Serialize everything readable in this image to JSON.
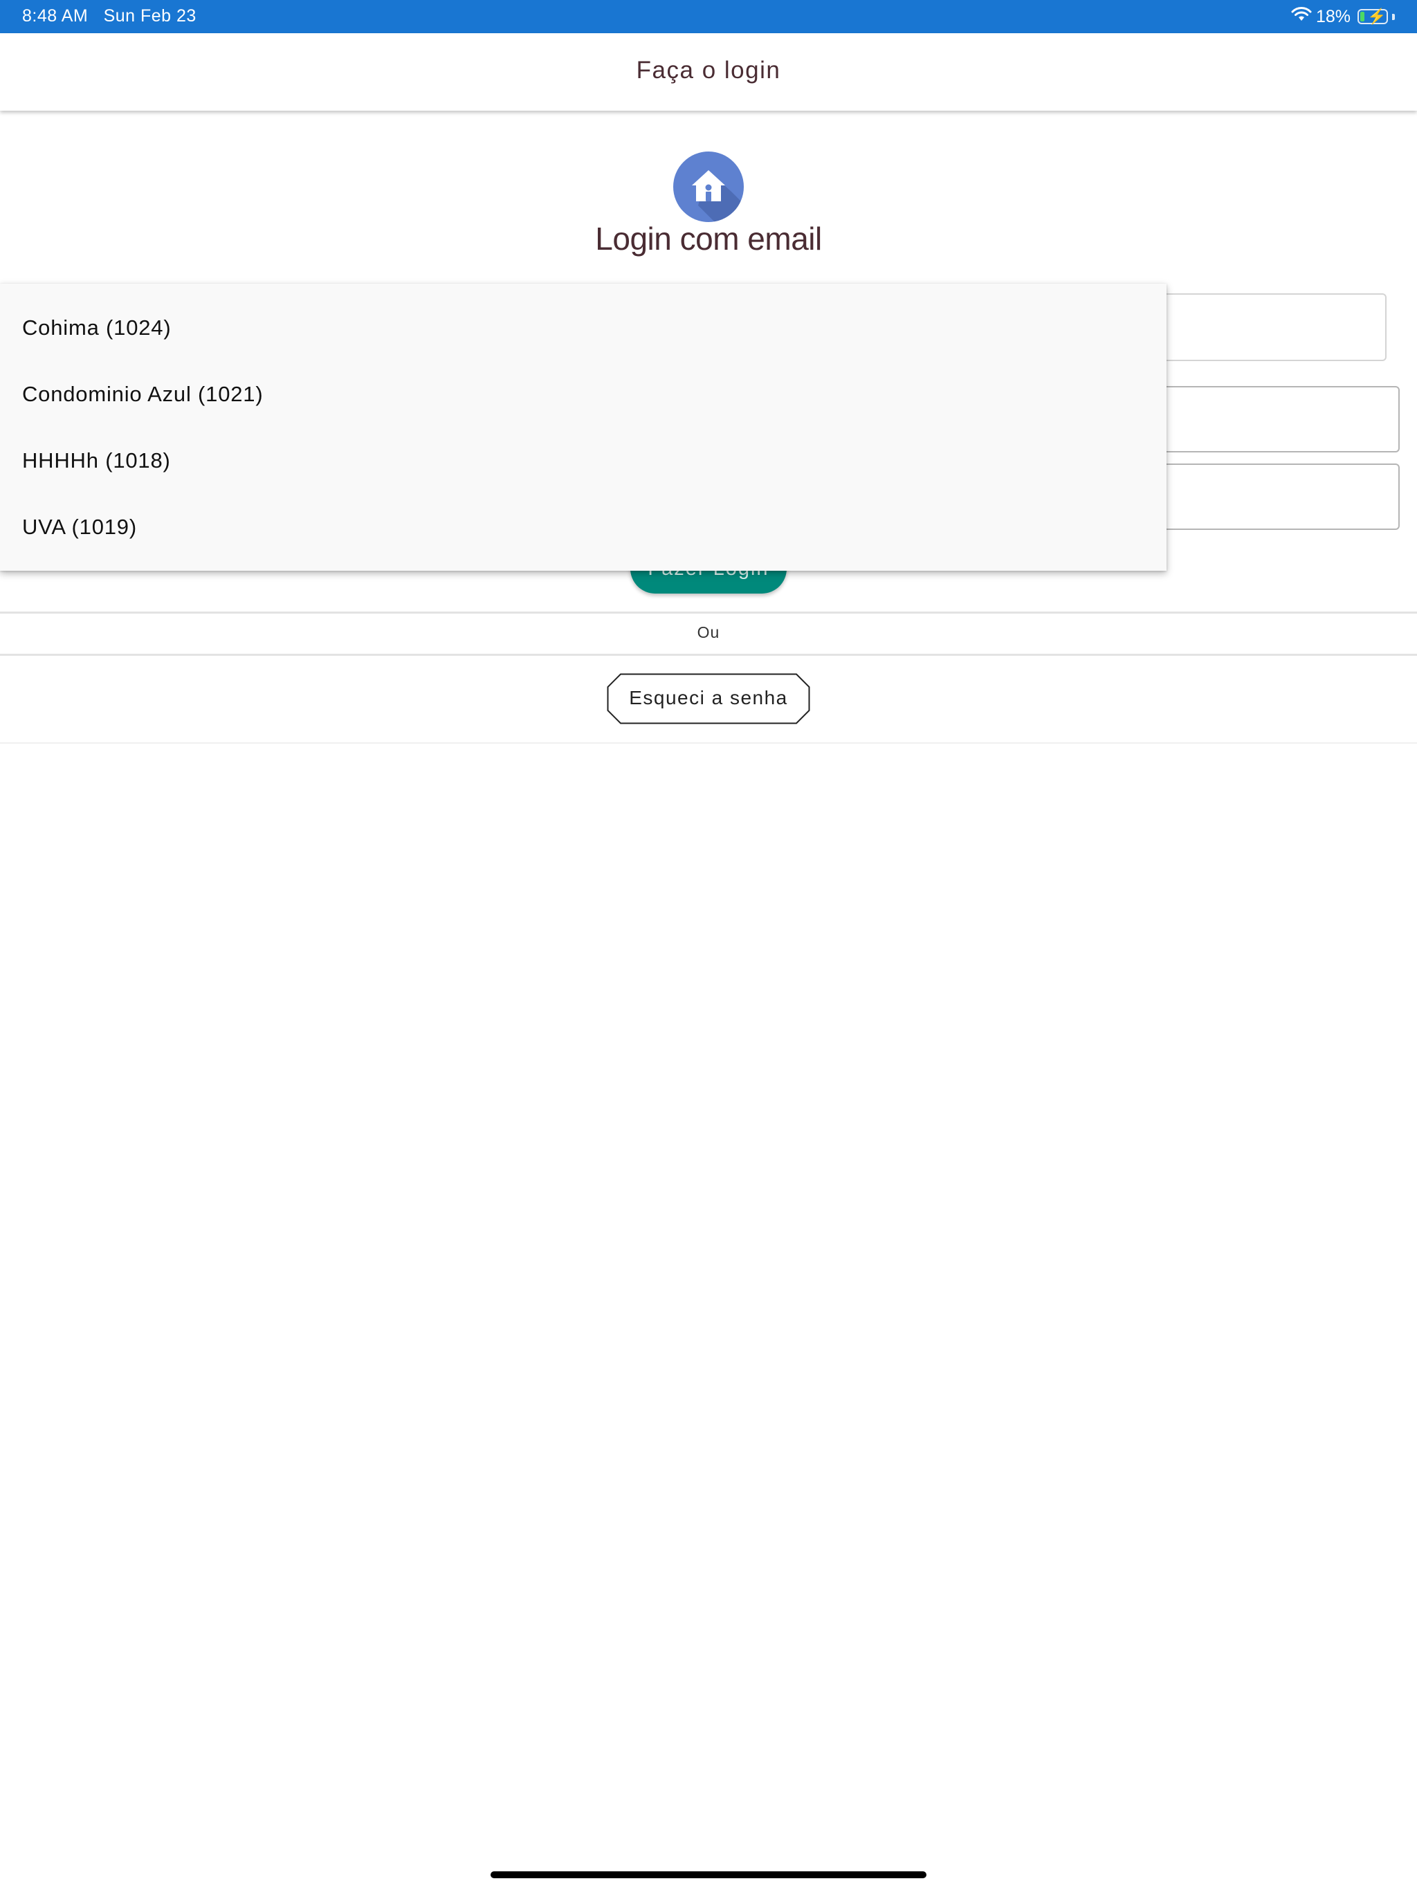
{
  "status_bar": {
    "time": "8:48 AM",
    "date": "Sun Feb 23",
    "battery_percent": "18%",
    "battery_level": 0.18,
    "charging": true,
    "wifi_icon": "wifi-icon",
    "battery_icon": "battery-charging-icon",
    "background_color": "#1976d2"
  },
  "app_bar": {
    "title": "Faça o login"
  },
  "main": {
    "logo_icon": "house-icon",
    "logo_color": "#5e81d0",
    "heading": "Login com email",
    "login_button_label": "Fazer Login",
    "login_button_color": "#00897b",
    "divider_text": "Ou",
    "forgot_password_label": "Esqueci a senha"
  },
  "dropdown": {
    "items": [
      {
        "label": "Cohima (1024)"
      },
      {
        "label": "Condominio Azul (1021)"
      },
      {
        "label": "HHHHh (1018)"
      },
      {
        "label": "UVA (1019)"
      }
    ]
  }
}
